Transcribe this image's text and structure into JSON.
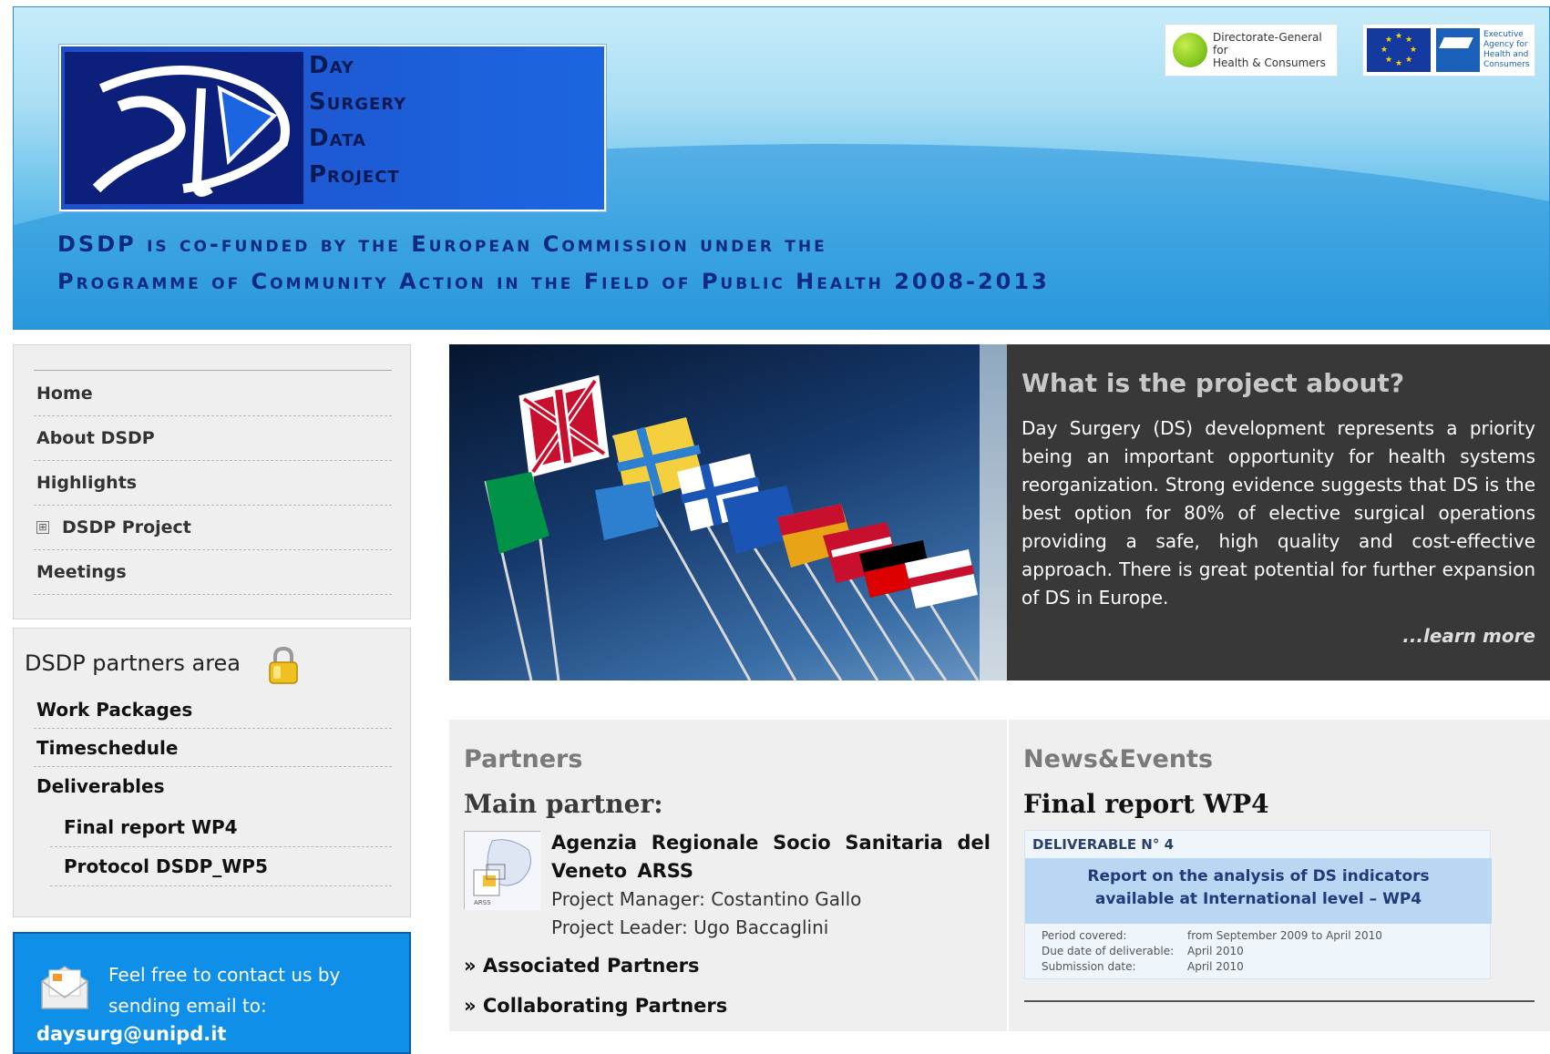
{
  "header": {
    "logo_lines": [
      "Day",
      "Surgery",
      "Data",
      "Project"
    ],
    "banner_line1": "DSDP is co-funded by the European Commission under the",
    "banner_line2": "Programme of Community Action in the Field of Public Health 2008-2013",
    "dg_logo_text_1": "Directorate-General for",
    "dg_logo_text_2": "Health & Consumers",
    "eu_logo_text_1": "Executive",
    "eu_logo_text_2": "Agency for",
    "eu_logo_text_3": "Health and",
    "eu_logo_text_4": "Consumers"
  },
  "sidebar": {
    "nav_items": [
      {
        "label": "Home"
      },
      {
        "label": "About DSDP"
      },
      {
        "label": "Highlights"
      },
      {
        "label": "DSDP Project",
        "expander": "⊞"
      },
      {
        "label": "Meetings"
      }
    ],
    "partners_area": {
      "title": "DSDP partners area",
      "items": [
        "Work Packages",
        "Timeschedule",
        "Deliverables"
      ],
      "sub_items": [
        "Final report WP4",
        "Protocol DSDP_WP5"
      ]
    },
    "contact": {
      "text": "Feel free to contact us by sending email to:",
      "email": "daysurg@unipd.it"
    }
  },
  "about": {
    "title": "What is the project about?",
    "body": "Day Surgery (DS) development represents a priority being an important opportunity for health systems reorganization. Strong evidence suggests that DS is the best option for 80% of elective surgical operations providing a safe, high quality and cost-effective approach. There is great potential for further expansion of DS in Europe.",
    "learn_more": "...learn more"
  },
  "partners": {
    "heading": "Partners",
    "main_partner_label": "Main partner:",
    "main_partner_name": "Agenzia Regionale Socio Sanitaria del Veneto ARSS",
    "project_manager": "Project Manager: Costantino Gallo",
    "project_leader": "Project Leader: Ugo Baccaglini",
    "associated_link": "» Associated Partners",
    "collaborating_link": "» Collaborating Partners"
  },
  "news": {
    "heading": "News&Events",
    "title": "Final report WP4",
    "deliverable": {
      "label": "DELIVERABLE N° 4",
      "title_line1": "Report on the analysis of DS indicators",
      "title_line2": "available at International level – WP4",
      "period_label": "Period covered:",
      "period_value": "from September 2009 to April 2010",
      "due_label": "Due date of deliverable:",
      "due_value": "April 2010",
      "submission_label": "Submission date:",
      "submission_value": "April 2010"
    }
  },
  "colors": {
    "header_blue": "#2a99dc",
    "contact_blue": "#0f8fe8",
    "about_panel": "#383838",
    "panel_gray": "#efefef"
  }
}
